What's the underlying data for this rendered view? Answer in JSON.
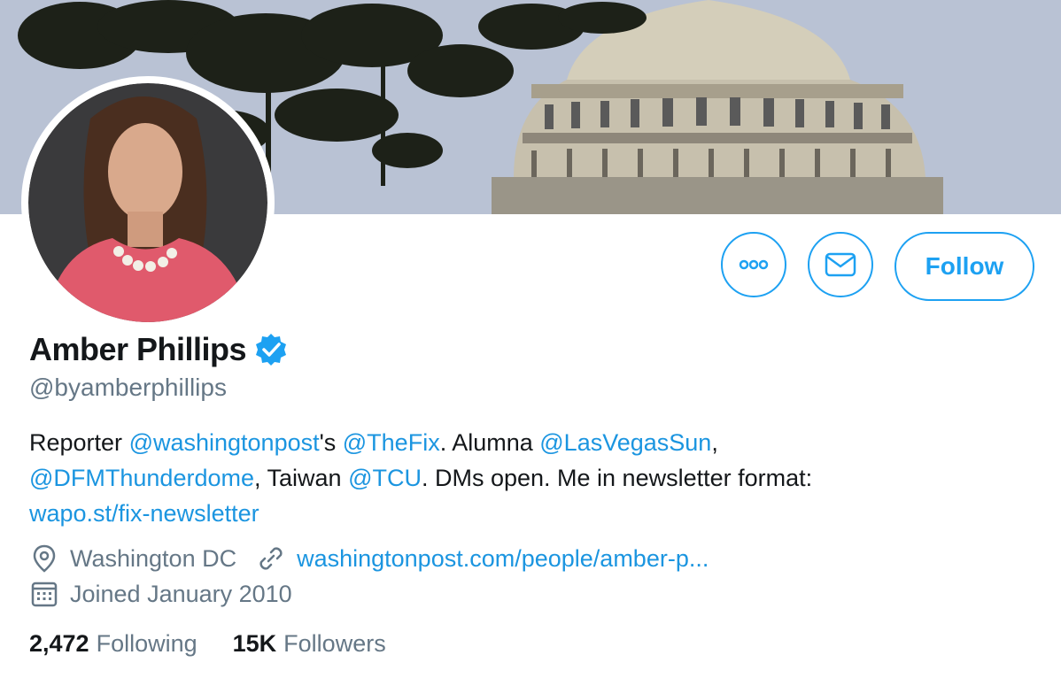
{
  "profile": {
    "name": "Amber Phillips",
    "handle": "@byamberphillips",
    "verified": true
  },
  "actions": {
    "more_icon": "more-icon",
    "message_icon": "mail-icon",
    "follow_label": "Follow"
  },
  "bio": {
    "t1": "Reporter ",
    "m1": "@washingtonpost",
    "t2": "'s ",
    "m2": "@TheFix",
    "t3": ".  Alumna ",
    "m3": "@LasVegasSun",
    "t4": ",",
    "m4": "@DFMThunderdome",
    "t5": ", Taiwan ",
    "m5": "@TCU",
    "t6": ". DMs open. Me in newsletter format:",
    "link": "wapo.st/fix-newsletter"
  },
  "meta": {
    "location": "Washington DC",
    "website": "washingtonpost.com/people/amber-p...",
    "joined": "Joined January 2010"
  },
  "stats": {
    "following_count": "2,472",
    "following_label": "Following",
    "followers_count": "15K",
    "followers_label": "Followers"
  },
  "colors": {
    "accent": "#1da1f2",
    "link": "#1b95e0",
    "text": "#14171a",
    "muted": "#657786"
  }
}
